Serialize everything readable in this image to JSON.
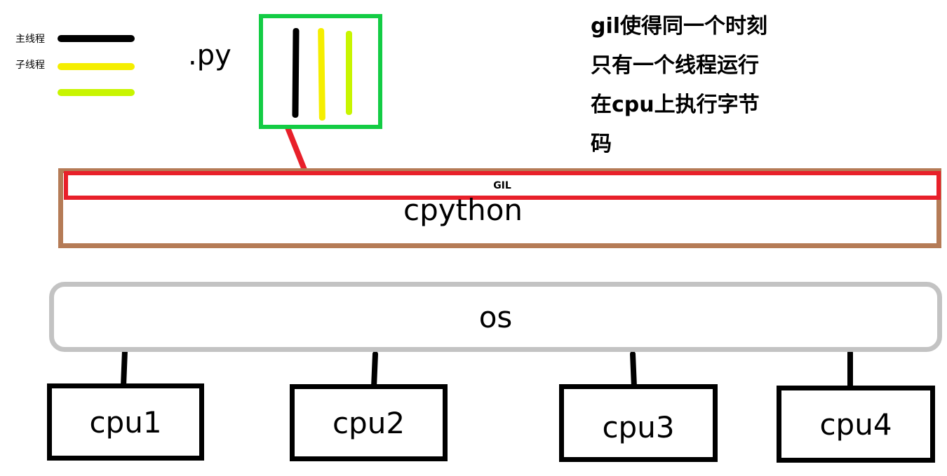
{
  "legend": {
    "items": [
      {
        "label": "主线程",
        "color": "#000000"
      },
      {
        "label": "子线程",
        "color": "#f5ee00"
      },
      {
        "label": "",
        "color": "#c8f500"
      }
    ]
  },
  "py_label": ".py",
  "py_threads": [
    {
      "color": "#000000"
    },
    {
      "color": "#f5ee00"
    },
    {
      "color": "#c8f500"
    }
  ],
  "annotation": {
    "lines": [
      "gil使得同一个时刻",
      "只有一个线程运行",
      "在cpu上执行字节",
      "码"
    ]
  },
  "cpython": {
    "label": "cpython",
    "gil_label": "GIL"
  },
  "os": {
    "label": "os"
  },
  "cpus": [
    {
      "label": "cpu1"
    },
    {
      "label": "cpu2"
    },
    {
      "label": "cpu3"
    },
    {
      "label": "cpu4"
    }
  ],
  "colors": {
    "py_box_border": "#13cc44",
    "gil_border": "#e8202a",
    "cpython_border": "#b57b56",
    "os_border": "#c3c3c3",
    "cpu_border": "#000000"
  }
}
